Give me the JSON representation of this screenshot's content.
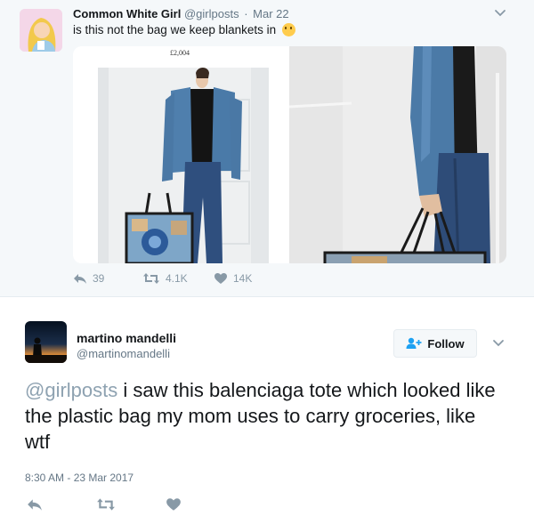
{
  "parent_tweet": {
    "name": "Common White Girl",
    "handle": "@girlposts",
    "separator": "·",
    "date": "Mar 22",
    "text": "is this not the bag we keep blankets in",
    "emoji": "thinking-face-emoji",
    "media": {
      "price_label": "£2,004"
    },
    "actions": {
      "reply_icon": "reply-icon",
      "replies": "39",
      "retweet_icon": "retweet-icon",
      "retweets": "4.1K",
      "like_icon": "heart-icon",
      "likes": "14K"
    },
    "menu_icon": "chevron-down-icon"
  },
  "tweet": {
    "name": "martino mandelli",
    "handle": "@martinomandelli",
    "follow_button": {
      "label": "Follow",
      "icon": "add-user-icon"
    },
    "menu_icon": "chevron-down-icon",
    "mention": "@girlposts",
    "text": " i saw this balenciaga tote which looked like the plastic bag my mom uses to carry groceries, like wtf",
    "timestamp": "8:30 AM - 23 Mar 2017",
    "actions": {
      "reply_icon": "reply-icon",
      "retweet_icon": "retweet-icon",
      "like_icon": "heart-icon"
    }
  },
  "colors": {
    "accent_blue": "#1da1f2",
    "mention": "#8ea2b1",
    "muted_text": "#657786",
    "icon_gray": "#8899a6",
    "parent_background": "#f5f8fa"
  }
}
